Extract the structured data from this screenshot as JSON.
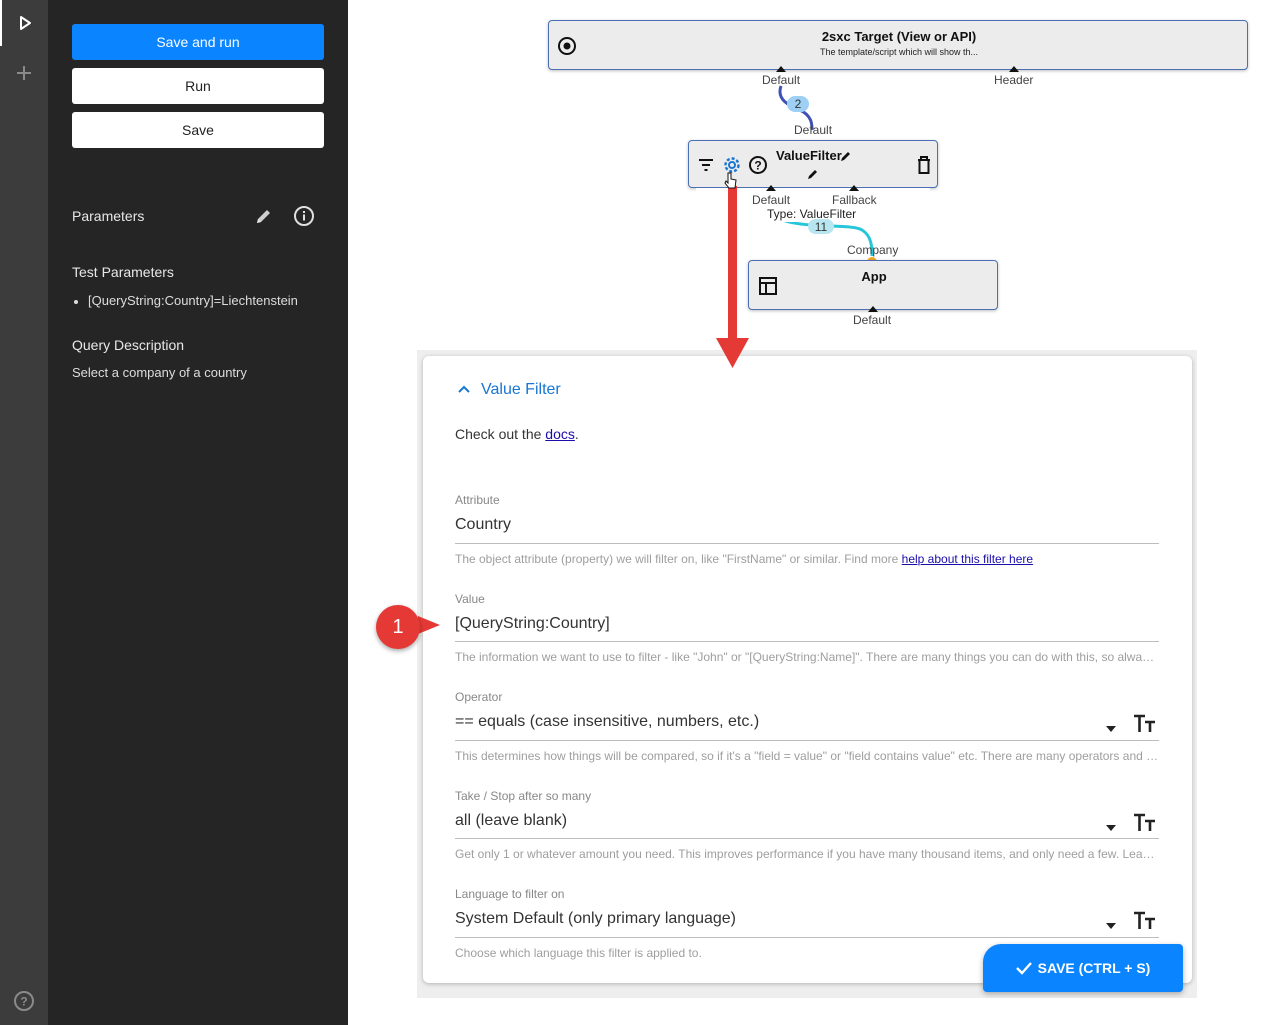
{
  "sidebar": {
    "save_and_run_label": "Save and run",
    "run_label": "Run",
    "save_label": "Save",
    "parameters_title": "Parameters",
    "test_parameters_title": "Test Parameters",
    "test_parameters": [
      "[QueryString:Country]=Liechtenstein"
    ],
    "query_description_title": "Query Description",
    "query_description": "Select a company of a country"
  },
  "graph": {
    "target_node": {
      "title": "2sxc Target (View or API)",
      "subtitle": "The template/script which will show th...",
      "ports_in": [
        "Default",
        "Header"
      ]
    },
    "connection_count_top": "2",
    "valuefilter_node": {
      "title": "ValueFilter",
      "out_port": "Default",
      "in_ports": [
        "Default",
        "Fallback"
      ],
      "type_label": "Type: ValueFilter"
    },
    "connection_count_mid": "11",
    "app_node": {
      "title": "App",
      "out_port": "Company",
      "in_port": "Default"
    }
  },
  "panel": {
    "section_title": "Value Filter",
    "intro_prefix": "Check out the ",
    "intro_link": "docs",
    "intro_suffix": ".",
    "fields": {
      "attribute": {
        "label": "Attribute",
        "value": "Country",
        "hint": "The object attribute (property) we will filter on, like \"FirstName\" or similar. Find more ",
        "hint_link": "help about this filter here"
      },
      "value": {
        "label": "Value",
        "value": "[QueryString:Country]",
        "hint": "The information we want to use to filter - like \"John\" or \"[QueryString:Name]\". There are many things you can do with this, so always ..."
      },
      "operator": {
        "label": "Operator",
        "value": "== equals (case insensitive, numbers, etc.)",
        "hint": "This determines how things will be compared, so if it's a \"field = value\" or \"field contains value\" etc. There are many operators and w..."
      },
      "take": {
        "label": "Take / Stop after so many",
        "value": "all (leave blank)",
        "hint": "Get only 1 or whatever amount you need. This improves performance if you have many thousand items, and only need a few. Leave ..."
      },
      "language": {
        "label": "Language to filter on",
        "value": "System Default (only primary language)",
        "hint": "Choose which language this filter is applied to."
      }
    },
    "save_button_label": "SAVE (CTRL + S)"
  },
  "annotation": {
    "badge_number": "1"
  },
  "icons": [
    "play-icon",
    "plus-icon",
    "help-circle-icon",
    "pencil-icon",
    "info-icon",
    "target-icon",
    "filter-icon",
    "gear-icon",
    "question-icon",
    "trash-icon",
    "table-icon",
    "chevron-up-icon",
    "dropdown-arrow-icon",
    "text-format-icon",
    "check-icon"
  ],
  "colors": {
    "accent": "#0a84ff",
    "sidebar_bg": "#252526",
    "rail_bg": "#3c3c3c",
    "annotation_red": "#e53935",
    "connection_blue": "#3f51b5",
    "connection_teal": "#26c6da"
  }
}
